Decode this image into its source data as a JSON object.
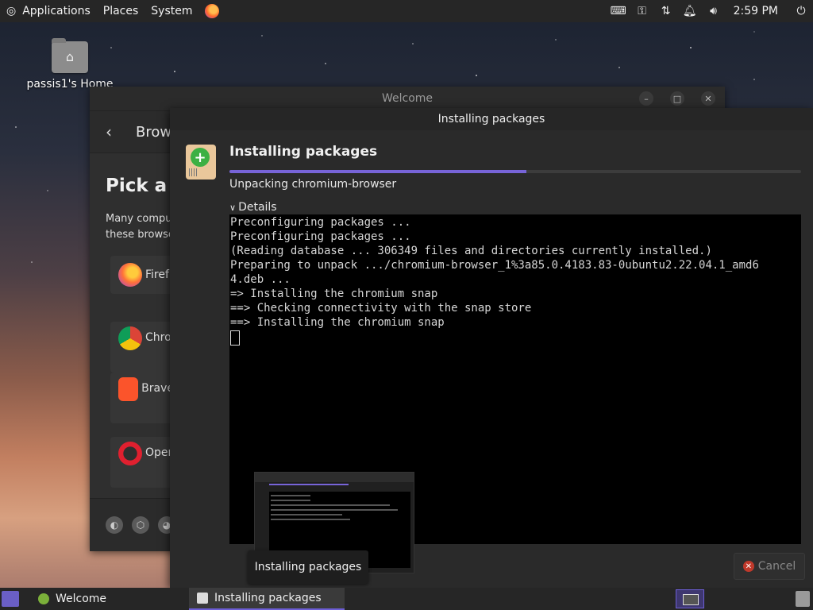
{
  "top_panel": {
    "menus": [
      "Applications",
      "Places",
      "System"
    ],
    "clock": "2:59 PM"
  },
  "desktop": {
    "home_label": "passis1's Home"
  },
  "welcome_window": {
    "title": "Welcome",
    "header_title": "Brow",
    "heading": "Pick a p",
    "desc_line1": "Many compu",
    "desc_line2": "these browse",
    "browsers": [
      "Firef",
      "Chro",
      "Brave",
      "Oper"
    ]
  },
  "install_dialog": {
    "title": "Installing packages",
    "heading": "Installing packages",
    "progress": 0.52,
    "status": "Unpacking chromium-browser",
    "details_label": "Details",
    "terminal_lines": [
      "Preconfiguring packages ...",
      "Preconfiguring packages ...",
      "(Reading database ... 306349 files and directories currently installed.)",
      "Preparing to unpack .../chromium-browser_1%3a85.0.4183.83-0ubuntu2.22.04.1_amd6",
      "4.deb ...",
      "=> Installing the chromium snap",
      "==> Checking connectivity with the snap store",
      "==> Installing the chromium snap"
    ],
    "cancel_label": "Cancel"
  },
  "tooltip": "Installing packages",
  "taskbar": {
    "tasks": [
      "Welcome",
      "Installing packages"
    ]
  },
  "colors": {
    "accent": "#7764d8",
    "panel": "#262626"
  }
}
